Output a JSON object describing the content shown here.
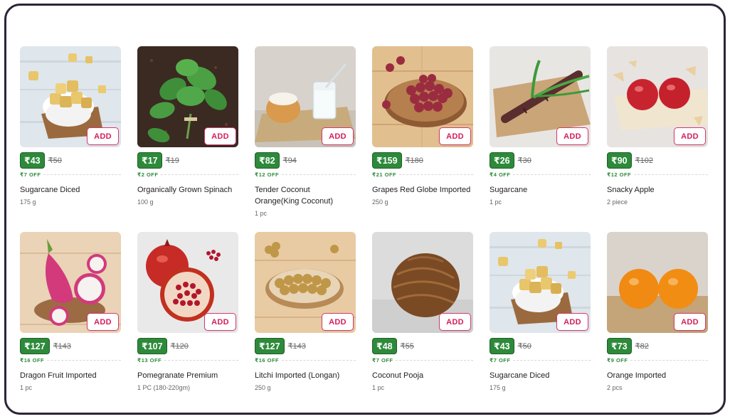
{
  "add_label": "ADD",
  "products": [
    {
      "name": "Sugarcane Diced",
      "qty": "175 g",
      "price": "₹43",
      "mrp": "₹50",
      "off": "₹7 OFF",
      "image": "sugarcane-diced-image"
    },
    {
      "name": "Organically Grown Spinach",
      "qty": "100 g",
      "price": "₹17",
      "mrp": "₹19",
      "off": "₹2 OFF",
      "image": "spinach-image"
    },
    {
      "name": "Tender Coconut Orange(King Coconut)",
      "qty": "1 pc",
      "price": "₹82",
      "mrp": "₹94",
      "off": "₹12 OFF",
      "image": "tender-coconut-image"
    },
    {
      "name": "Grapes Red Globe Imported",
      "qty": "250 g",
      "price": "₹159",
      "mrp": "₹180",
      "off": "₹21 OFF",
      "image": "grapes-image"
    },
    {
      "name": "Sugarcane",
      "qty": "1 pc",
      "price": "₹26",
      "mrp": "₹30",
      "off": "₹4 OFF",
      "image": "sugarcane-image"
    },
    {
      "name": "Snacky Apple",
      "qty": "2 piece",
      "price": "₹90",
      "mrp": "₹102",
      "off": "₹12 OFF",
      "image": "apple-image"
    },
    {
      "name": "Dragon Fruit Imported",
      "qty": "1 pc",
      "price": "₹127",
      "mrp": "₹143",
      "off": "₹16 OFF",
      "image": "dragon-fruit-image"
    },
    {
      "name": "Pomegranate Premium",
      "qty": "1 PC (180-220gm)",
      "price": "₹107",
      "mrp": "₹120",
      "off": "₹13 OFF",
      "image": "pomegranate-image"
    },
    {
      "name": "Litchi Imported (Longan)",
      "qty": "250 g",
      "price": "₹127",
      "mrp": "₹143",
      "off": "₹16 OFF",
      "image": "longan-image"
    },
    {
      "name": "Coconut Pooja",
      "qty": "1 pc",
      "price": "₹48",
      "mrp": "₹55",
      "off": "₹7 OFF",
      "image": "coconut-image"
    },
    {
      "name": "Sugarcane Diced",
      "qty": "175 g",
      "price": "₹43",
      "mrp": "₹50",
      "off": "₹7 OFF",
      "image": "sugarcane-diced-image"
    },
    {
      "name": "Orange Imported",
      "qty": "2 pcs",
      "price": "₹73",
      "mrp": "₹82",
      "off": "₹9 OFF",
      "image": "orange-image"
    }
  ],
  "colors": {
    "price_badge": "#2d8a3a",
    "add_button": "#d21e5c",
    "frame_border": "#2e2536"
  }
}
